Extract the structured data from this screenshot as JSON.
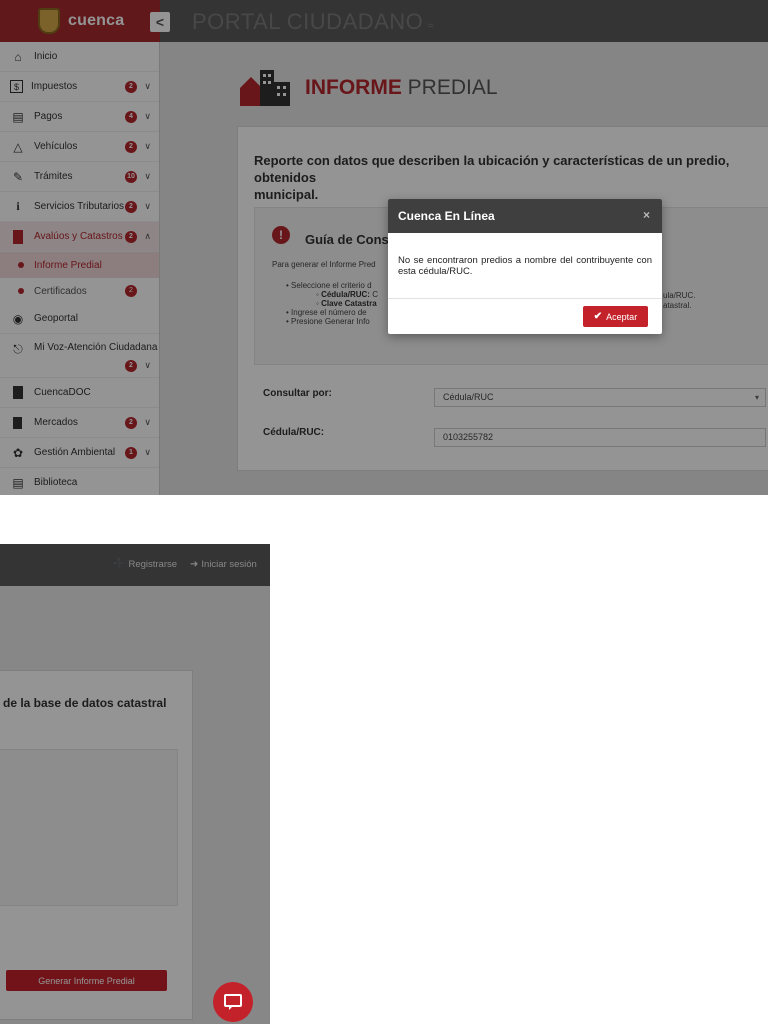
{
  "header": {
    "brand_name": "cuenca",
    "collapse_glyph": "<",
    "portal_title": "PORTAL CIUDADANO",
    "rss_glyph": "≈"
  },
  "sidebar": {
    "items": [
      {
        "label": "Inicio",
        "icon": "home-icon",
        "badge": "",
        "chevron": ""
      },
      {
        "label": "Impuestos",
        "icon": "dollar-icon",
        "badge": "2",
        "chevron": "∨"
      },
      {
        "label": "Pagos",
        "icon": "money-icon",
        "badge": "4",
        "chevron": "∨"
      },
      {
        "label": "Vehículos",
        "icon": "car-icon",
        "badge": "2",
        "chevron": "∨"
      },
      {
        "label": "Trámites",
        "icon": "document-hand-icon",
        "badge": "10",
        "chevron": "∨"
      },
      {
        "label": "Servicios Tributarios",
        "icon": "info-icon",
        "badge": "2",
        "chevron": "∨"
      },
      {
        "label": "Avalúos y Catastros",
        "icon": "building-icon",
        "badge": "2",
        "chevron": "∧"
      }
    ],
    "subitems": [
      {
        "label": "Informe Predial",
        "badge": ""
      },
      {
        "label": "Certificados",
        "badge": "2"
      }
    ],
    "items_after": [
      {
        "label": "Geoportal",
        "icon": "globe-icon",
        "badge": "",
        "chevron": ""
      },
      {
        "label": "Mi Voz-Atención Ciudadana",
        "icon": "headset-icon",
        "badge": "2",
        "chevron": "∨"
      },
      {
        "label": "CuencaDOC",
        "icon": "file-icon",
        "badge": "",
        "chevron": ""
      },
      {
        "label": "Mercados",
        "icon": "bookmark-icon",
        "badge": "2",
        "chevron": "∨"
      },
      {
        "label": "Gestión Ambiental",
        "icon": "leaf-icon",
        "badge": "1",
        "chevron": "∨"
      },
      {
        "label": "Biblioteca",
        "icon": "book-icon",
        "badge": "",
        "chevron": ""
      }
    ]
  },
  "main": {
    "title_accent": "INFORME",
    "title_rest": "PREDIAL",
    "description": "Reporte con datos que describen la ubicación y características de un predio, obtenidos",
    "description_line2": "municipal.",
    "guide_icon_glyph": "!",
    "guide_title": "Guía de Consu",
    "guide_intro": "Para generar el Informe Pred",
    "guide_bullet1": "Seleccione el criterio d",
    "guide_sub1_label": "Cédula/RUC:",
    "guide_sub1_text": "C",
    "guide_sub2_label": "Clave Catastra",
    "guide_bullet2": "Ingrese el número de",
    "guide_bullet3": "Presione Generar Info",
    "guide_frag1": "ula/RUC.",
    "guide_frag2": "atastral.",
    "form": {
      "consultar_label": "Consultar por:",
      "consultar_value": "Cédula/RUC",
      "consultar_caret": "▾",
      "cedula_label": "Cédula/RUC:",
      "cedula_value": "0103255782"
    }
  },
  "modal": {
    "title": "Cuenca En Línea",
    "close_glyph": "×",
    "message": "No se encontraron predios a nombre del contribuyente con esta cédula/RUC.",
    "accept_glyph": "✔",
    "accept_label": "Aceptar"
  },
  "bottom": {
    "register_label": "Registrarse",
    "register_icon_glyph": "➕",
    "login_label": "Iniciar sesión",
    "login_icon_glyph": "➜",
    "description_tail": "de la base de datos catastral",
    "generate_button": "Generar Informe Predial"
  },
  "colors": {
    "brand_red": "#a82a2f",
    "accent_red": "#c4222b",
    "header_gray": "#5a5a5a",
    "modal_header": "#3f3f3f"
  }
}
